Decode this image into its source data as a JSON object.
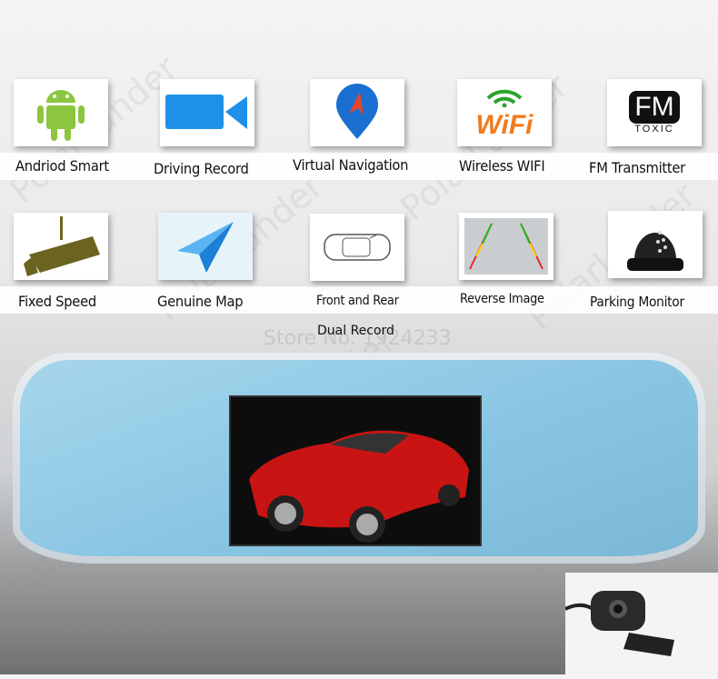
{
  "watermark": "PolarLander",
  "features_row1": [
    {
      "label": "Andriod Smart",
      "icon": "android-icon"
    },
    {
      "label": "Driving Record",
      "icon": "video-camera-icon"
    },
    {
      "label": "Virtual Navigation",
      "icon": "map-pin-icon"
    },
    {
      "label": "Wireless WIFI",
      "icon": "wifi-icon"
    },
    {
      "label": "FM Transmitter",
      "icon": "fm-icon"
    }
  ],
  "features_row2": [
    {
      "label": "Fixed Speed",
      "icon": "speed-camera-icon"
    },
    {
      "label": "Genuine Map",
      "icon": "paper-plane-icon"
    },
    {
      "label": "Front and Rear",
      "icon": "car-top-view-icon"
    },
    {
      "label": "Reverse Image",
      "icon": "parking-guide-icon"
    },
    {
      "label": "Parking Monitor",
      "icon": "dome-camera-icon"
    }
  ],
  "dual_record": "Dual Record",
  "store": "Store No. 1924233",
  "icon_text": {
    "wifi": "WiFi",
    "fm": "FM",
    "fm_sub": "TOXIC"
  }
}
